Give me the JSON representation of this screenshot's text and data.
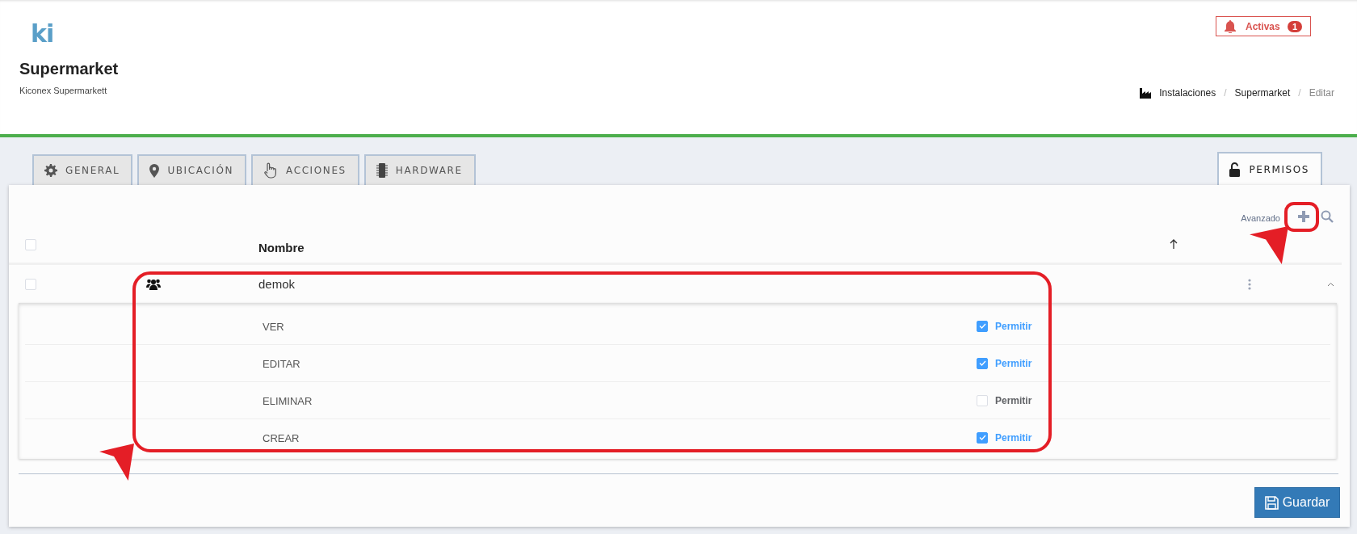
{
  "header": {
    "logo": "ki",
    "title": "Supermarket",
    "subtitle": "Kiconex Supermarkett",
    "alert": {
      "label": "Activas",
      "count": "1"
    },
    "breadcrumb": [
      {
        "kind": "link",
        "label": "Instalaciones"
      },
      {
        "kind": "separator",
        "label": "/"
      },
      {
        "kind": "link",
        "label": "Supermarket"
      },
      {
        "kind": "separator",
        "label": "/"
      },
      {
        "kind": "current",
        "label": "Editar"
      }
    ]
  },
  "tabs": [
    {
      "label": "GENERAL",
      "selected": false
    },
    {
      "label": "UBICACIÓN",
      "selected": false
    },
    {
      "label": "ACCIONES",
      "selected": false
    },
    {
      "label": "HARDWARE",
      "selected": false
    },
    {
      "label": "PERMISOS",
      "selected": true
    }
  ],
  "toolbar": {
    "advanced_label": "Avanzado"
  },
  "table": {
    "select_all": {
      "checked": false
    },
    "columns": [
      {
        "label": "Nombre"
      }
    ],
    "rows": [
      {
        "name": "demok",
        "checked": false,
        "expanded": true,
        "permissions": [
          {
            "label": "VER",
            "option": "Permitir",
            "checked": true
          },
          {
            "label": "EDITAR",
            "option": "Permitir",
            "checked": true
          },
          {
            "label": "ELIMINAR",
            "option": "Permitir",
            "checked": false
          },
          {
            "label": "CREAR",
            "option": "Permitir",
            "checked": true
          }
        ]
      }
    ]
  },
  "save_button": {
    "label": "Guardar"
  },
  "annotations": [
    {
      "kind": "frame"
    },
    {
      "kind": "frame"
    },
    {
      "kind": "arrow"
    },
    {
      "kind": "arrow"
    }
  ]
}
